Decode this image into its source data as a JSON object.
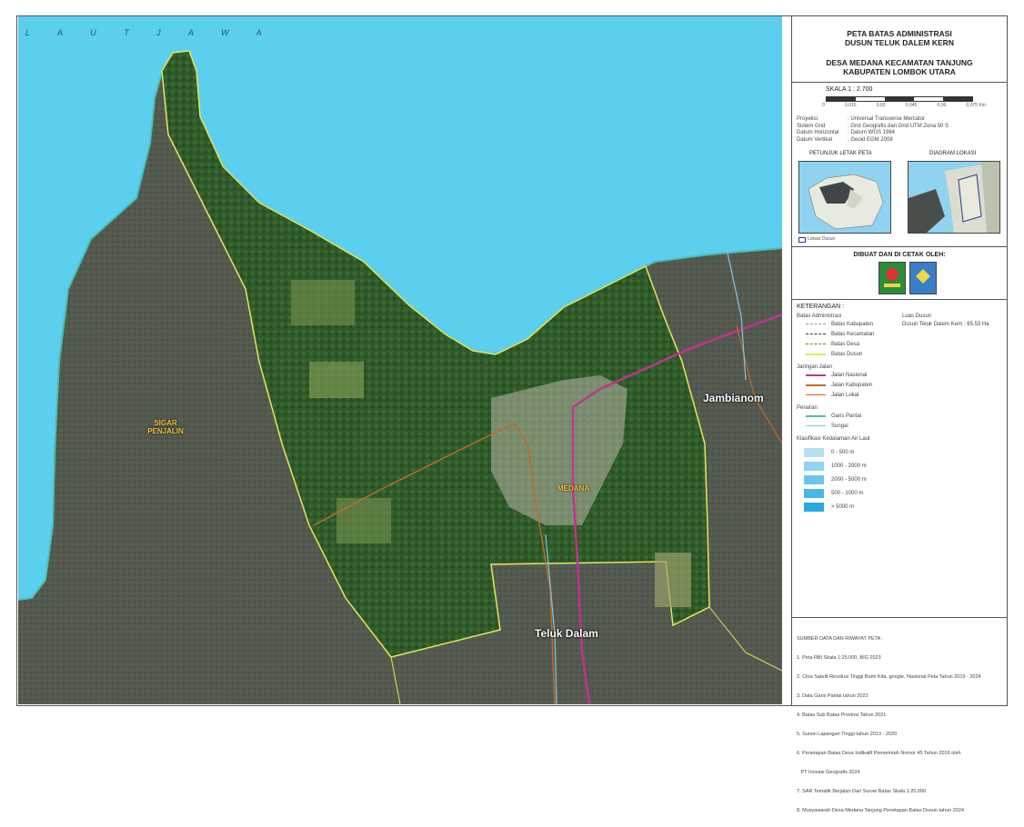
{
  "map": {
    "sea_label": "L A U T  J A W A",
    "places": {
      "jambianom": "Jambianom",
      "teluk_dalam": "Teluk Dalam",
      "medana": "MEDANA",
      "sigar_penjalin": "SIGAR\nPENJALIN"
    },
    "colors": {
      "sea": "#5ccfee",
      "land": "#555a50",
      "vegetation": "#2f5a2a",
      "boundary": "#e6e65a",
      "national_road": "#c0348c",
      "district_road": "#c06a2a"
    }
  },
  "title": {
    "line1": "PETA BATAS ADMINISTRASI",
    "line2": "DUSUN TELUK DALEM KERN",
    "line3": "DESA MEDANA KECAMATAN TANJUNG",
    "line4": "KABUPATEN LOMBOK UTARA"
  },
  "scale": {
    "label": "SKALA 1 : 2.700",
    "ticks": [
      "0",
      "0,015",
      "0,03",
      "0,045",
      "0,06",
      "0,075 Km"
    ]
  },
  "projection": [
    {
      "k": "Proyeksi",
      "v": ": Universal Transverse Mercator"
    },
    {
      "k": "Sistem Grid",
      "v": ": Grid Geografis dan Grid UTM Zona 50 S"
    },
    {
      "k": "Datum Horizontal",
      "v": ": Datum WGS 1984"
    },
    {
      "k": "Datum Vertikal",
      "v": ": Geoid EGM 2008"
    }
  ],
  "insets": {
    "left_title": "PETUNJUK LETAK PETA",
    "right_title": "DIAGRAM LOKASI",
    "legend_note": "Lokasi Dusun"
  },
  "maker": {
    "title": "DIBUAT DAN DI CETAK OLEH:"
  },
  "legend": {
    "title": "KETERANGAN :",
    "admin_title": "Batas Administrasi",
    "admin": [
      {
        "label": "Batas Kabupaten",
        "color": "#999999"
      },
      {
        "label": "Batas Kecamatan",
        "color": "#333333"
      },
      {
        "label": "Batas Desa",
        "color": "#7b7b2a"
      },
      {
        "label": "Batas Dusun",
        "color": "#e6e65a"
      }
    ],
    "road_title": "Jaringan Jalan",
    "roads": [
      {
        "label": "Jalan Nasional",
        "color": "#c0348c"
      },
      {
        "label": "Jalan Kabupaten",
        "color": "#c06a2a"
      },
      {
        "label": "Jalan Lokal",
        "color": "#c06a2a"
      }
    ],
    "water_title": "Perairan",
    "water": [
      {
        "label": "Garis Pantai",
        "color": "#48c0b0"
      },
      {
        "label": "Sungai",
        "color": "#7fc8e8"
      }
    ],
    "depth_title": "Klasifikasi Kedalaman Air Laut",
    "depth": [
      {
        "label": "0 - 500 m",
        "color": "#b4e2f4"
      },
      {
        "label": "1000 - 2000 m",
        "color": "#8fd3f0"
      },
      {
        "label": "2000 - 5000 m",
        "color": "#6cc6ec"
      },
      {
        "label": "500 - 1000 m",
        "color": "#4ab8e6"
      },
      {
        "label": "> 5000 m",
        "color": "#2aa9df"
      }
    ],
    "area_title": "Luas Dusun",
    "area_value": "Dusun Teluk Dalem Kern : 65.53 Ha"
  },
  "sources": {
    "title": "SUMBER DATA DAN RIWAYAT PETA :",
    "items": [
      "1. Peta RBI Skala 1:25.000, BIG 2023",
      "2. Citra Satelit Resolusi Tinggi Bumi Kita, google, Nasional Peta Tahun 2019 - 2024",
      "3. Data Garis Pantai tahun 2023",
      "4. Batas Sub Batas Provinsi Tahun 2021",
      "5. Survei Lapangan Tinggi tahun 2013 - 2020",
      "6. Penetapan Batas Desa Indikatif Pemerintah Nomor 45 Tahun 2016 oleh",
      "   PT Inovasi Geografis 2024",
      "7. SAR Tematik Berjalan Dari Survei Batas Skala 1:25.000",
      "8. Musyawarah Desa Medana Tanjung Penetapan Batas Dusun tahun 2024"
    ]
  }
}
